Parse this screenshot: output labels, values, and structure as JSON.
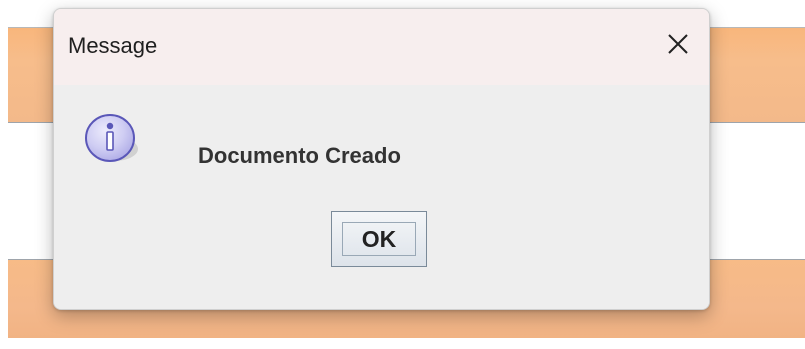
{
  "dialog": {
    "title": "Message",
    "message": "Documento Creado",
    "ok_label": "OK"
  },
  "icons": {
    "info": "info-icon",
    "close": "close-icon"
  },
  "colors": {
    "background_orange": "#f7bd8b",
    "dialog_background": "#eeeeee",
    "titlebar_background": "#f7eeee",
    "info_icon_fill": "#c9c7f0",
    "info_icon_stroke": "#5a57b8",
    "button_border": "#7a8a99"
  }
}
